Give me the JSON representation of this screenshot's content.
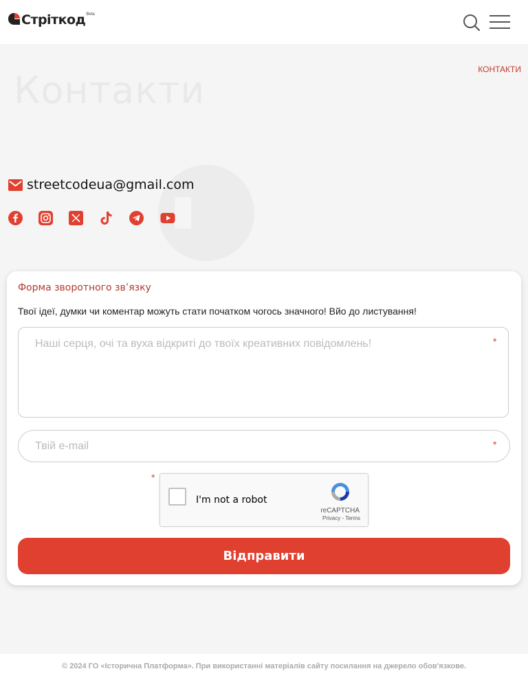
{
  "header": {
    "logo_text": "Стріткод",
    "logo_badge": "Beta",
    "search_icon": "search-icon",
    "menu_icon": "hamburger-menu-icon"
  },
  "breadcrumb": "КОНТАКТИ",
  "page_title": "Контакти",
  "contact": {
    "email_icon": "mail-icon",
    "email": "streetcodeua@gmail.com",
    "socials": [
      "facebook-icon",
      "instagram-icon",
      "x-icon",
      "tiktok-icon",
      "telegram-icon",
      "youtube-icon"
    ]
  },
  "form": {
    "title": "Форма зворотного зв’язку",
    "description": "Твої ідеї, думки чи коментар можуть стати початком чогось значного! Вйо до листування!",
    "message_placeholder": "Наші серця, очі та вуха відкриті до твоїх креативних повідомлень!",
    "email_placeholder": "Твій e-mail",
    "required_mark": "*",
    "captcha": {
      "label": "I'm not a robot",
      "brand": "reCAPTCHA",
      "links": "Privacy - Terms"
    },
    "submit_label": "Відправити"
  },
  "footer": {
    "copyright": "© 2024 ГО «Історична Платформа». При використанні матеріалів сайту посилання на джерело обов'язкове."
  },
  "colors": {
    "accent": "#e04030",
    "title_red": "#b03a2e",
    "background": "#f5f5f5"
  }
}
